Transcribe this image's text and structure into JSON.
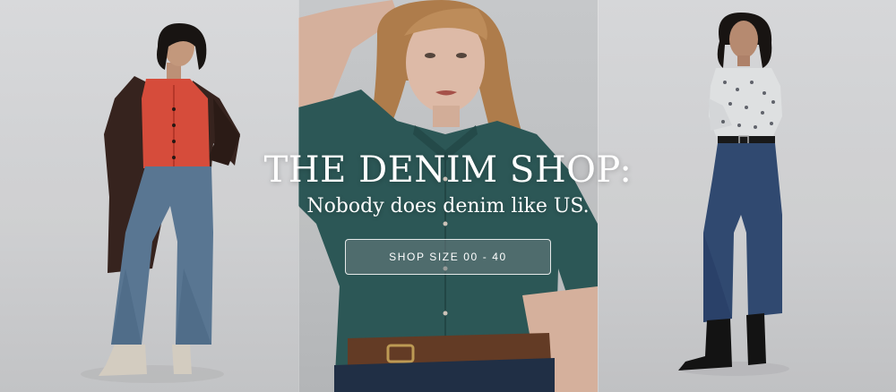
{
  "hero": {
    "headline": "THE DENIM SHOP:",
    "subheadline": "Nobody does denim like US.",
    "cta_label": "SHOP SIZE 00 - 40"
  },
  "images": [
    {
      "name": "model-left-photo",
      "description_colors": {
        "coat": "#3a2620",
        "cardigan": "#e4513f",
        "jeans": "#5f7e9c",
        "boots": "#e1d9cc"
      }
    },
    {
      "name": "model-center-photo",
      "description_colors": {
        "shirt": "#2f5d5c",
        "hair": "#b98450",
        "belt": "#6a3f28"
      }
    },
    {
      "name": "model-right-photo",
      "description_colors": {
        "blouse": "#eceef0",
        "jeans": "#344e78",
        "boots": "#151515"
      }
    }
  ]
}
